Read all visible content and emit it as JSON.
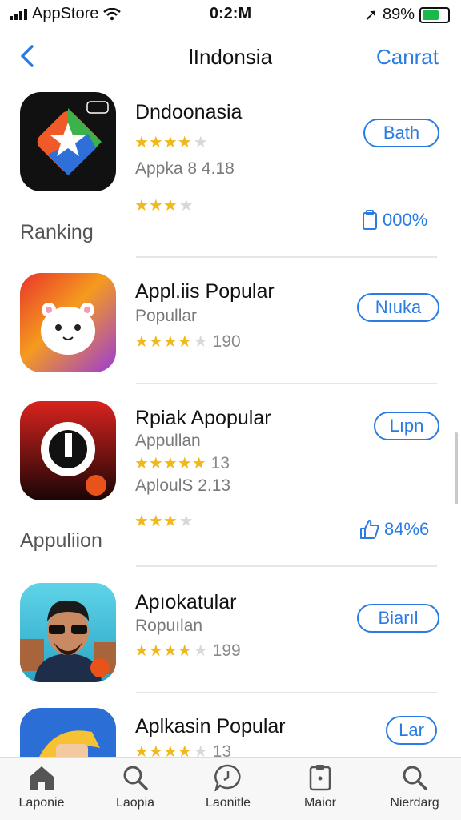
{
  "status": {
    "carrier": "AppStore",
    "time": "0:2:M",
    "battery": "89%"
  },
  "nav": {
    "title": "lIndonsia",
    "cancel": "Canrat"
  },
  "apps": [
    {
      "name": "Dndoonasia",
      "subtitle": "",
      "stars_line1": {
        "filled": 4,
        "count": ""
      },
      "meta": "Appka 8 4.18",
      "button": "Bath"
    },
    {
      "name": "Appl.iis Popular",
      "subtitle": "Popullar",
      "stars_line1": {
        "filled": 3.5,
        "count": "190"
      },
      "meta": "",
      "button": "Nıuka"
    },
    {
      "name": "Rpiak Apopular",
      "subtitle": "Appullan",
      "stars_line1": {
        "filled": 4.5,
        "count": "13"
      },
      "meta": "AploulS 2.13",
      "button": "Lıpn"
    },
    {
      "name": "Apıokatular",
      "subtitle": "Ropuılan",
      "stars_line1": {
        "filled": 3.5,
        "count": "199"
      },
      "meta": "",
      "button": "Biarıl"
    },
    {
      "name": "Aplkasin Popular",
      "subtitle": "",
      "stars_line1": {
        "filled": 4,
        "count": "13"
      },
      "meta": "",
      "button": "Lar"
    }
  ],
  "sections": [
    {
      "label": "Ranking",
      "stars": 3,
      "percent": "000%"
    },
    {
      "label": "Appuliion",
      "stars": 3,
      "percent": "84%6"
    }
  ],
  "tabs": [
    {
      "label": "Laponie",
      "icon": "home-icon"
    },
    {
      "label": "Laopia",
      "icon": "search-icon"
    },
    {
      "label": "Laonitle",
      "icon": "chat-clock-icon"
    },
    {
      "label": "Maior",
      "icon": "clipboard-icon"
    },
    {
      "label": "Nierdarg",
      "icon": "search-icon"
    }
  ],
  "colors": {
    "accent": "#2a7be4",
    "star": "#f1b81b"
  }
}
